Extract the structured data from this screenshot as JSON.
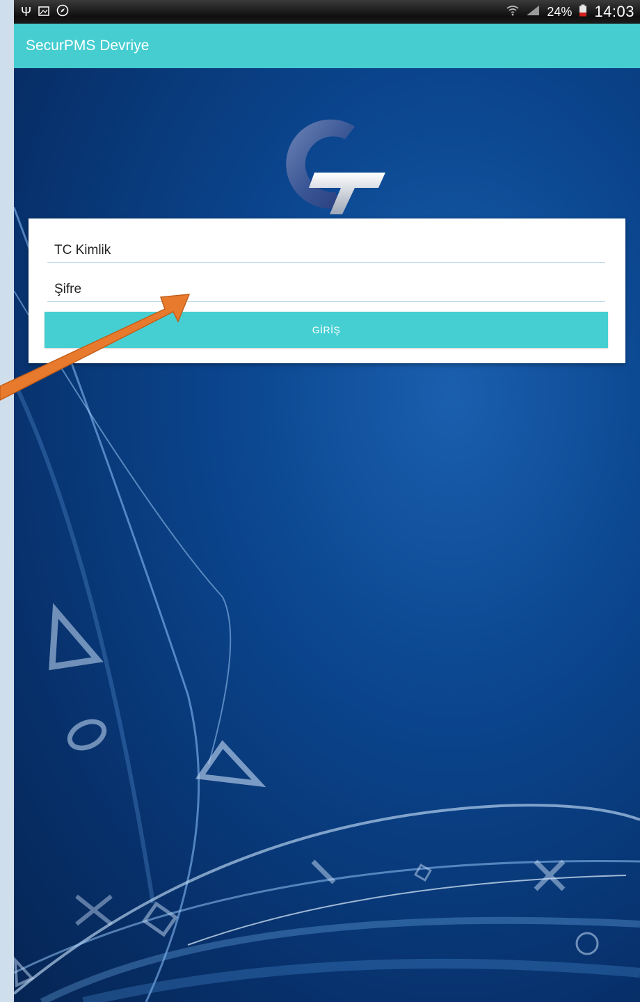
{
  "status_bar": {
    "battery": "24%",
    "time": "14:03",
    "left_icons": [
      "usb-icon",
      "image-notification-icon",
      "compass-icon"
    ],
    "right_icons": [
      "wifi-icon",
      "signal-icon",
      "battery-icon"
    ]
  },
  "app_bar": {
    "title": "SecurPMS Devriye"
  },
  "login_form": {
    "id_field_hint": "TC Kimlik",
    "password_field_hint": "Şifre",
    "login_button_label": "GİRİŞ"
  },
  "colors": {
    "accent": "#45cdd0",
    "background_blue": "#0b468f",
    "annotation_arrow": "#e87a2e"
  }
}
